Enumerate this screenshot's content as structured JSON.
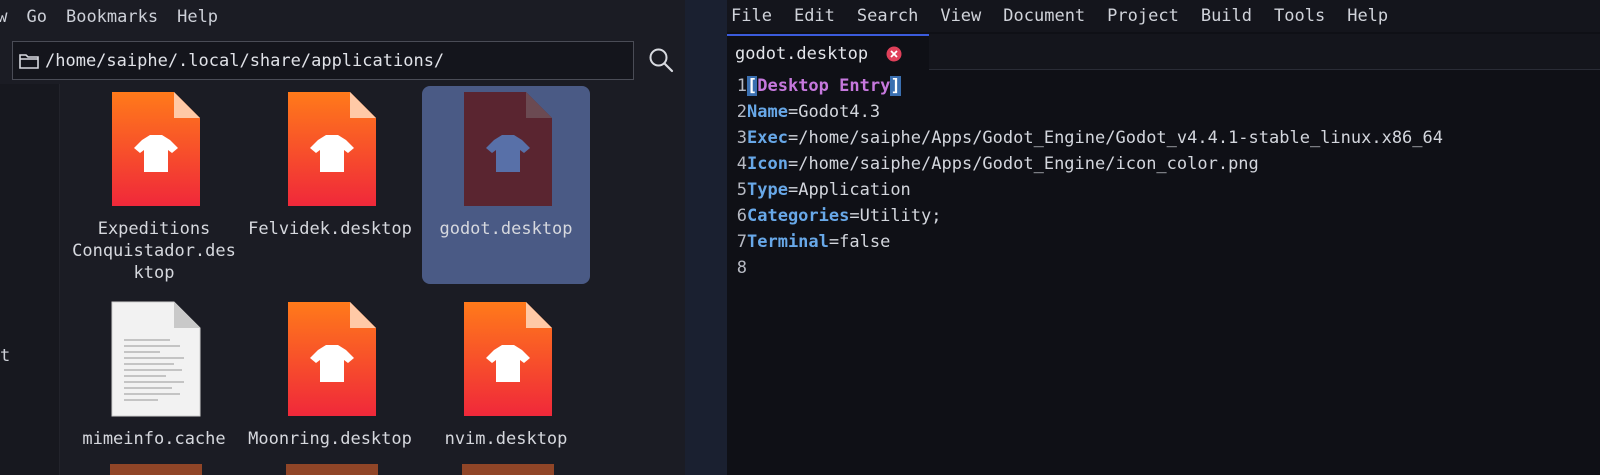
{
  "file_manager": {
    "menu": [
      "ew",
      "Go",
      "Bookmarks",
      "Help"
    ],
    "path": "/home/saiphe/.local/share/applications/",
    "sidebar_fragment": "t",
    "files": [
      {
        "label": "Expeditions Conquistador.desktop",
        "type": "desktop",
        "selected": false
      },
      {
        "label": "Felvidek.desktop",
        "type": "desktop",
        "selected": false
      },
      {
        "label": "godot.desktop",
        "type": "desktop",
        "selected": true
      },
      {
        "label": "mimeinfo.cache",
        "type": "text",
        "selected": false
      },
      {
        "label": "Moonring.desktop",
        "type": "desktop",
        "selected": false
      },
      {
        "label": "nvim.desktop",
        "type": "desktop",
        "selected": false
      }
    ],
    "file_label_lines": {
      "f0": [
        "Expeditions",
        "Conquistador.des",
        "ktop"
      ]
    }
  },
  "editor": {
    "menu": [
      "File",
      "Edit",
      "Search",
      "View",
      "Document",
      "Project",
      "Build",
      "Tools",
      "Help"
    ],
    "tab_title": "godot.desktop",
    "lines": [
      {
        "n": "1",
        "section": "Desktop Entry"
      },
      {
        "n": "2",
        "key": "Name",
        "value": "Godot4.3"
      },
      {
        "n": "3",
        "key": "Exec",
        "value": "/home/saiphe/Apps/Godot_Engine/Godot_v4.4.1-stable_linux.x86_64"
      },
      {
        "n": "4",
        "key": "Icon",
        "value": "/home/saiphe/Apps/Godot_Engine/icon_color.png"
      },
      {
        "n": "5",
        "key": "Type",
        "value": "Application"
      },
      {
        "n": "6",
        "key": "Categories",
        "value": "Utility;"
      },
      {
        "n": "7",
        "key": "Terminal",
        "value": "false"
      },
      {
        "n": "8"
      }
    ]
  },
  "colors": {
    "selection": "#4a5a85",
    "desktop_icon_top": "#ff7a1a",
    "desktop_icon_bottom": "#f0283a",
    "key": "#68a8e8",
    "section": "#c678dd",
    "tab_close": "#e0405a"
  }
}
